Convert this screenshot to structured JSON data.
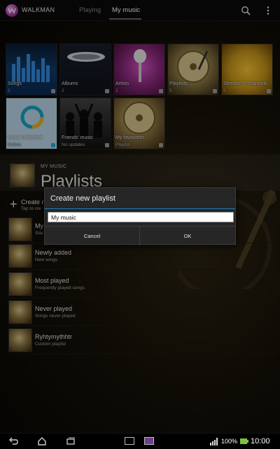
{
  "app": {
    "title": "WALKMAN",
    "brand_color": "#a43aa0"
  },
  "tabs": [
    {
      "label": "Playing",
      "active": false
    },
    {
      "label": "My music",
      "active": true
    }
  ],
  "tiles": [
    {
      "label": "Songs",
      "count": "2",
      "icon": "music-note-icon"
    },
    {
      "label": "Albums",
      "count": "2",
      "icon": "disc-icon"
    },
    {
      "label": "Artists",
      "count": "2",
      "icon": "person-icon"
    },
    {
      "label": "Playlists",
      "count": "5",
      "icon": "playlist-icon"
    },
    {
      "label": "SensMe™ channels",
      "count": "9",
      "icon": "heart-icon"
    },
    {
      "label": "Music Unlimited",
      "sub": "Online",
      "icon": "cloud-icon"
    },
    {
      "label": "Friends' music",
      "sub": "No updates",
      "icon": "friends-icon"
    },
    {
      "label": "My favourites",
      "sub": "Playlist",
      "icon": "star-icon"
    }
  ],
  "section": {
    "kicker": "MY MUSIC",
    "title": "Playlists"
  },
  "create_row": {
    "label": "Create n",
    "sub": "Tap to cre"
  },
  "playlists": [
    {
      "title": "My",
      "sub": "Star"
    },
    {
      "title": "Newly added",
      "sub": "New songs"
    },
    {
      "title": "Most played",
      "sub": "Frequently played songs"
    },
    {
      "title": "Never played",
      "sub": "Songs never played"
    },
    {
      "title": "Ryhtymythhtr",
      "sub": "Custom playlist"
    }
  ],
  "dialog": {
    "title": "Create new playlist",
    "input_value": "My music",
    "cancel_label": "Cancel",
    "ok_label": "OK",
    "accent_color": "#1e7fbf"
  },
  "status": {
    "battery": "100%",
    "time": "10:00"
  }
}
